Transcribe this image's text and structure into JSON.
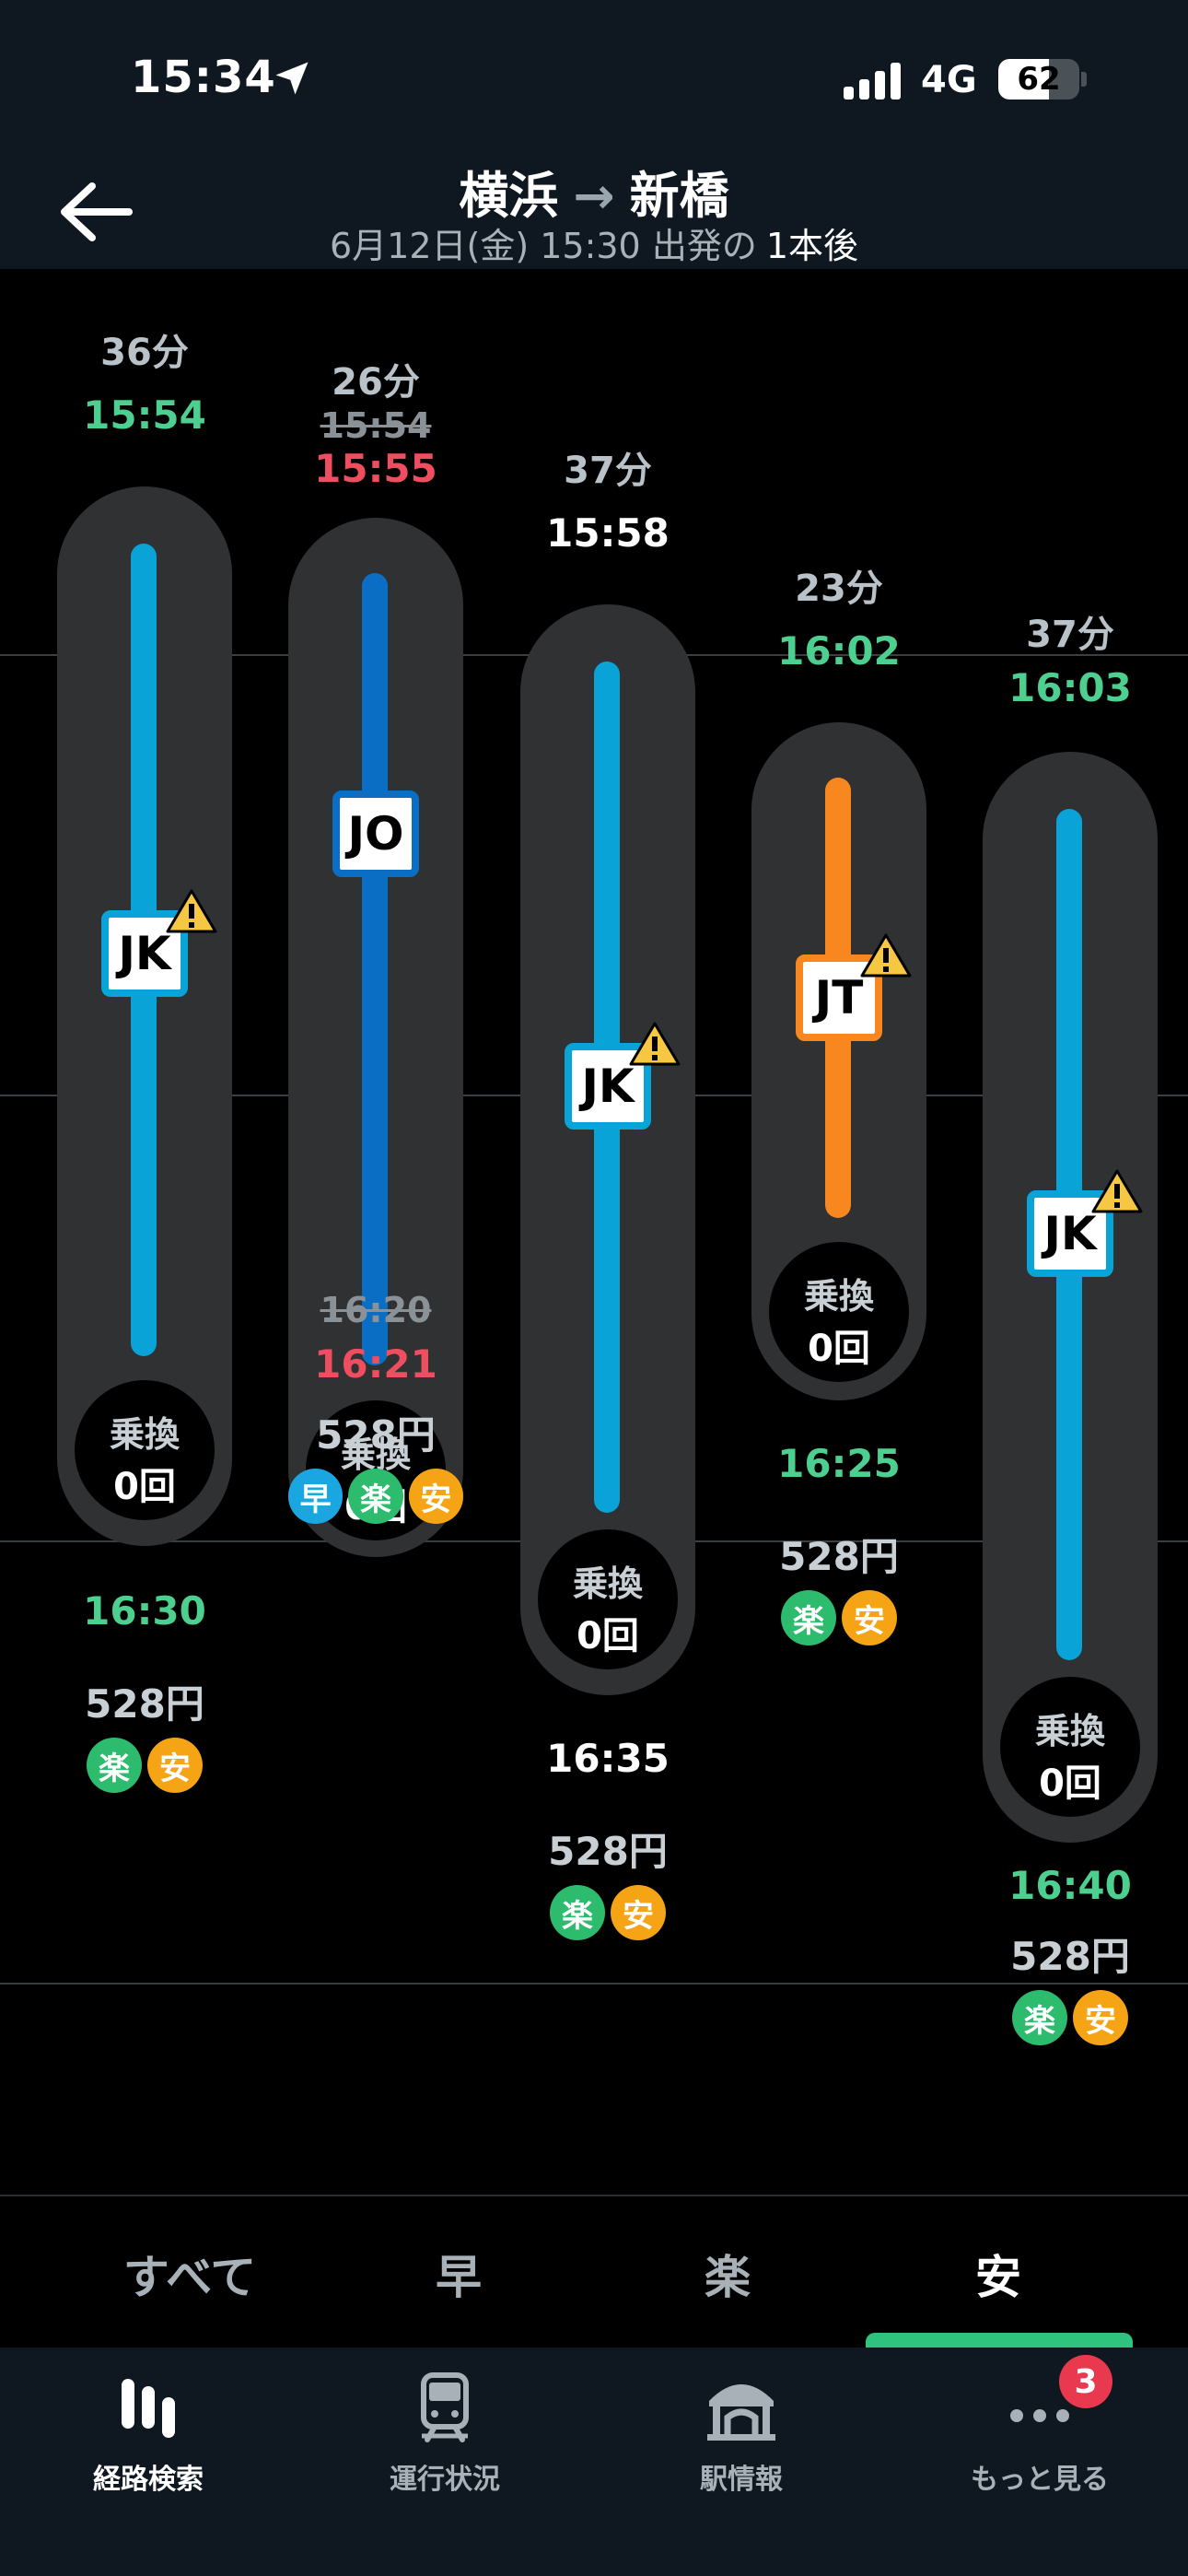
{
  "status_bar": {
    "time": "15:34",
    "network": "4G",
    "battery": "62",
    "battery_level": 0.62
  },
  "header": {
    "from": "横浜",
    "arrow": "→",
    "to": "新橋",
    "date_time": "6月12日(金) 15:30 出発の",
    "after": "1本後"
  },
  "routes": [
    {
      "duration": "36分",
      "depart": "15:54",
      "line": "JK",
      "line_color": "#0aa3d8",
      "transfer_label": "乗換",
      "transfers": "0回",
      "arrive": "16:30",
      "price": "528円",
      "tags": [
        "楽",
        "安"
      ]
    },
    {
      "duration": "26分",
      "depart_scheduled": "15:54",
      "depart": "15:55",
      "line": "JO",
      "line_color": "#0a6fc4",
      "transfer_label": "乗換",
      "transfers": "0回",
      "arrive_scheduled": "16:20",
      "arrive": "16:21",
      "price": "528円",
      "tags": [
        "早",
        "楽",
        "安"
      ]
    },
    {
      "duration": "37分",
      "depart": "15:58",
      "line": "JK",
      "line_color": "#0aa3d8",
      "transfer_label": "乗換",
      "transfers": "0回",
      "arrive": "16:35",
      "price": "528円",
      "tags": [
        "楽",
        "安"
      ]
    },
    {
      "duration": "23分",
      "depart": "16:02",
      "line": "JT",
      "line_color": "#f7871e",
      "transfer_label": "乗換",
      "transfers": "0回",
      "arrive": "16:25",
      "price": "528円",
      "tags": [
        "楽",
        "安"
      ]
    },
    {
      "duration": "37分",
      "depart": "16:03",
      "line": "JK",
      "line_color": "#0aa3d8",
      "transfer_label": "乗換",
      "transfers": "0回",
      "arrive": "16:40",
      "price": "528円",
      "tags": [
        "楽",
        "安"
      ]
    }
  ],
  "filter_tabs": [
    "すべて",
    "早",
    "楽",
    "安"
  ],
  "active_filter": "安",
  "bottom_nav": {
    "items": [
      "経路検索",
      "運行状況",
      "駅情報",
      "もっと見る"
    ],
    "active": "経路検索",
    "more_badge": "3"
  },
  "colors": {
    "accent": "#2fc47d",
    "on_time": "#4dcf8f",
    "delayed": "#ef4d60",
    "warning": "#f6c742"
  }
}
